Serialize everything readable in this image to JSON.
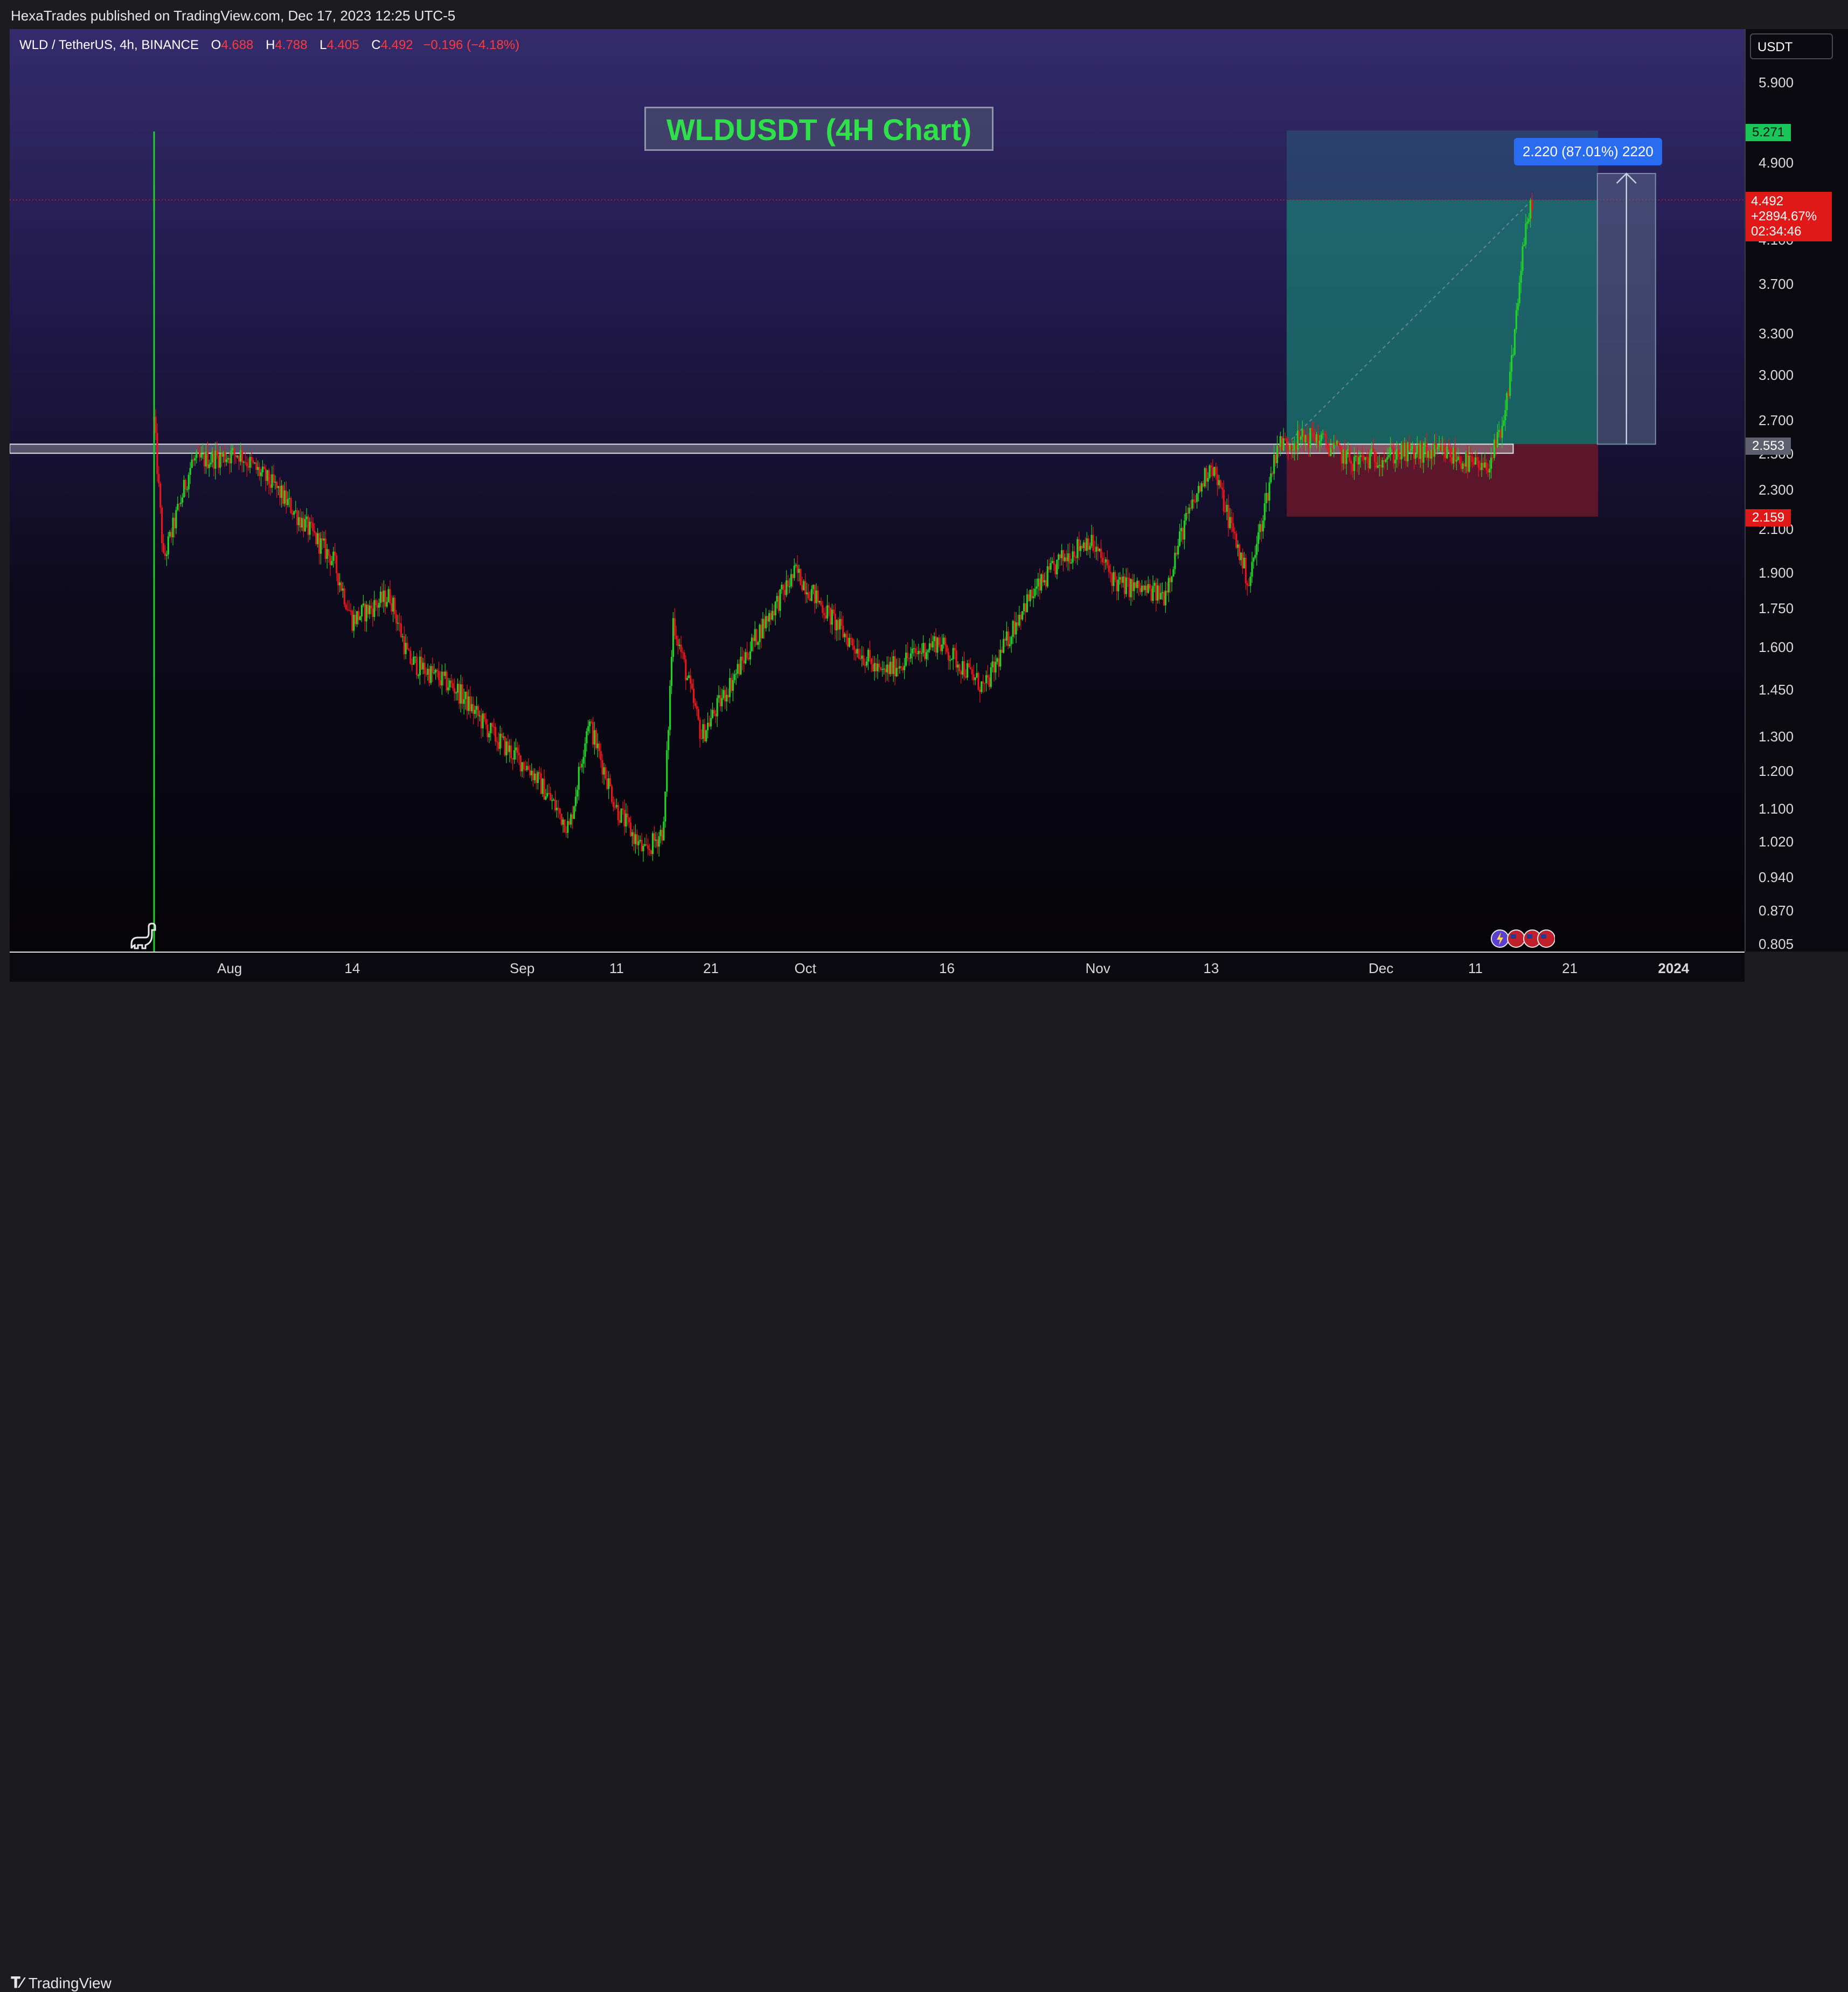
{
  "publisher": "HexaTrades published on TradingView.com, Dec 17, 2023 12:25 UTC-5",
  "symbol": {
    "name": "WLD / TetherUS, 4h, BINANCE",
    "open_label": "O",
    "open": "4.688",
    "high_label": "H",
    "high": "4.788",
    "low_label": "L",
    "low": "4.405",
    "close_label": "C",
    "close": "4.492",
    "change": "−0.196 (−4.18%)"
  },
  "currency": "USDT",
  "title": "WLDUSDT (4H Chart)",
  "measure_label": "2.220 (87.01%) 2220",
  "tags": {
    "top_green": "5.271",
    "current_price": "4.492",
    "current_pct": "+2894.67%",
    "countdown": "02:34:46",
    "zone": "2.553",
    "stop": "2.159"
  },
  "footer": {
    "brand": "TradingView",
    "logo_icon": "tradingview-logo-icon"
  },
  "colors": {
    "up": "#22d128",
    "down": "#e8151b",
    "title": "#2fe04a",
    "target_zone": "#1a8a7a",
    "stop_zone": "#7a1a2a",
    "measure": "#2a6cf0"
  },
  "chart_data": {
    "type": "candlestick",
    "title": "WLDUSDT (4H Chart)",
    "y_scale": "log",
    "ylim": [
      0.805,
      6.2
    ],
    "y_ticks": [
      5.9,
      4.9,
      4.1,
      3.7,
      3.3,
      3.0,
      2.7,
      2.5,
      2.3,
      2.1,
      1.9,
      1.75,
      1.6,
      1.45,
      1.3,
      1.2,
      1.1,
      1.02,
      0.94,
      0.87,
      0.805
    ],
    "y_tick_labels": [
      "5.900",
      "4.900",
      "4.100",
      "3.700",
      "3.300",
      "3.000",
      "2.700",
      "2.500",
      "2.300",
      "2.100",
      "1.900",
      "1.750",
      "1.600",
      "1.450",
      "1.300",
      "1.200",
      "1.100",
      "1.020",
      "0.940",
      "0.870",
      "0.805"
    ],
    "x_tick_labels": [
      "Aug",
      "14",
      "Sep",
      "11",
      "21",
      "Oct",
      "16",
      "Nov",
      "13",
      "Dec",
      "11",
      "21",
      "2024"
    ],
    "x_tick_dates": [
      "2023-08-01",
      "2023-08-14",
      "2023-09-01",
      "2023-09-11",
      "2023-09-21",
      "2023-10-01",
      "2023-10-16",
      "2023-11-01",
      "2023-11-13",
      "2023-12-01",
      "2023-12-11",
      "2023-12-21",
      "2024-01-01"
    ],
    "x_range": [
      "2023-07-24",
      "2024-01-10"
    ],
    "price_path": [
      {
        "date": "2023-07-24",
        "price": 2.7
      },
      {
        "date": "2023-07-25",
        "price": 1.95
      },
      {
        "date": "2023-07-28",
        "price": 2.45
      },
      {
        "date": "2023-08-02",
        "price": 2.5
      },
      {
        "date": "2023-08-06",
        "price": 2.3
      },
      {
        "date": "2023-08-12",
        "price": 1.95
      },
      {
        "date": "2023-08-14",
        "price": 1.7
      },
      {
        "date": "2023-08-18",
        "price": 1.8
      },
      {
        "date": "2023-08-20",
        "price": 1.55
      },
      {
        "date": "2023-08-25",
        "price": 1.45
      },
      {
        "date": "2023-08-29",
        "price": 1.3
      },
      {
        "date": "2023-09-02",
        "price": 1.2
      },
      {
        "date": "2023-09-06",
        "price": 1.05
      },
      {
        "date": "2023-09-08",
        "price": 1.35
      },
      {
        "date": "2023-09-11",
        "price": 1.1
      },
      {
        "date": "2023-09-14",
        "price": 0.99
      },
      {
        "date": "2023-09-16",
        "price": 1.05
      },
      {
        "date": "2023-09-17",
        "price": 1.7
      },
      {
        "date": "2023-09-20",
        "price": 1.3
      },
      {
        "date": "2023-09-26",
        "price": 1.65
      },
      {
        "date": "2023-09-30",
        "price": 1.9
      },
      {
        "date": "2023-10-05",
        "price": 1.65
      },
      {
        "date": "2023-10-09",
        "price": 1.5
      },
      {
        "date": "2023-10-15",
        "price": 1.62
      },
      {
        "date": "2023-10-20",
        "price": 1.45
      },
      {
        "date": "2023-10-24",
        "price": 1.75
      },
      {
        "date": "2023-10-28",
        "price": 1.95
      },
      {
        "date": "2023-10-31",
        "price": 2.05
      },
      {
        "date": "2023-11-03",
        "price": 1.85
      },
      {
        "date": "2023-11-08",
        "price": 1.8
      },
      {
        "date": "2023-11-10",
        "price": 2.1
      },
      {
        "date": "2023-11-13",
        "price": 2.45
      },
      {
        "date": "2023-11-17",
        "price": 1.85
      },
      {
        "date": "2023-11-20",
        "price": 2.55
      },
      {
        "date": "2023-11-24",
        "price": 2.6
      },
      {
        "date": "2023-11-28",
        "price": 2.45
      },
      {
        "date": "2023-12-03",
        "price": 2.5
      },
      {
        "date": "2023-12-08",
        "price": 2.5
      },
      {
        "date": "2023-12-12",
        "price": 2.4
      },
      {
        "date": "2023-12-14",
        "price": 2.65
      },
      {
        "date": "2023-12-15",
        "price": 3.2
      },
      {
        "date": "2023-12-16",
        "price": 4.0
      },
      {
        "date": "2023-12-17",
        "price": 4.49
      }
    ],
    "annotations": {
      "horizontal_zone": [
        2.5,
        2.553
      ],
      "vertical_line_date": "2023-07-24",
      "long_position": {
        "start": "2023-11-21",
        "end": "2023-12-24",
        "entry": 2.553,
        "target": 4.49,
        "stop": 2.159,
        "box_top": 5.271
      },
      "measure_arrow": {
        "date": "2023-12-27",
        "from": 2.553,
        "to": 4.773
      }
    }
  }
}
